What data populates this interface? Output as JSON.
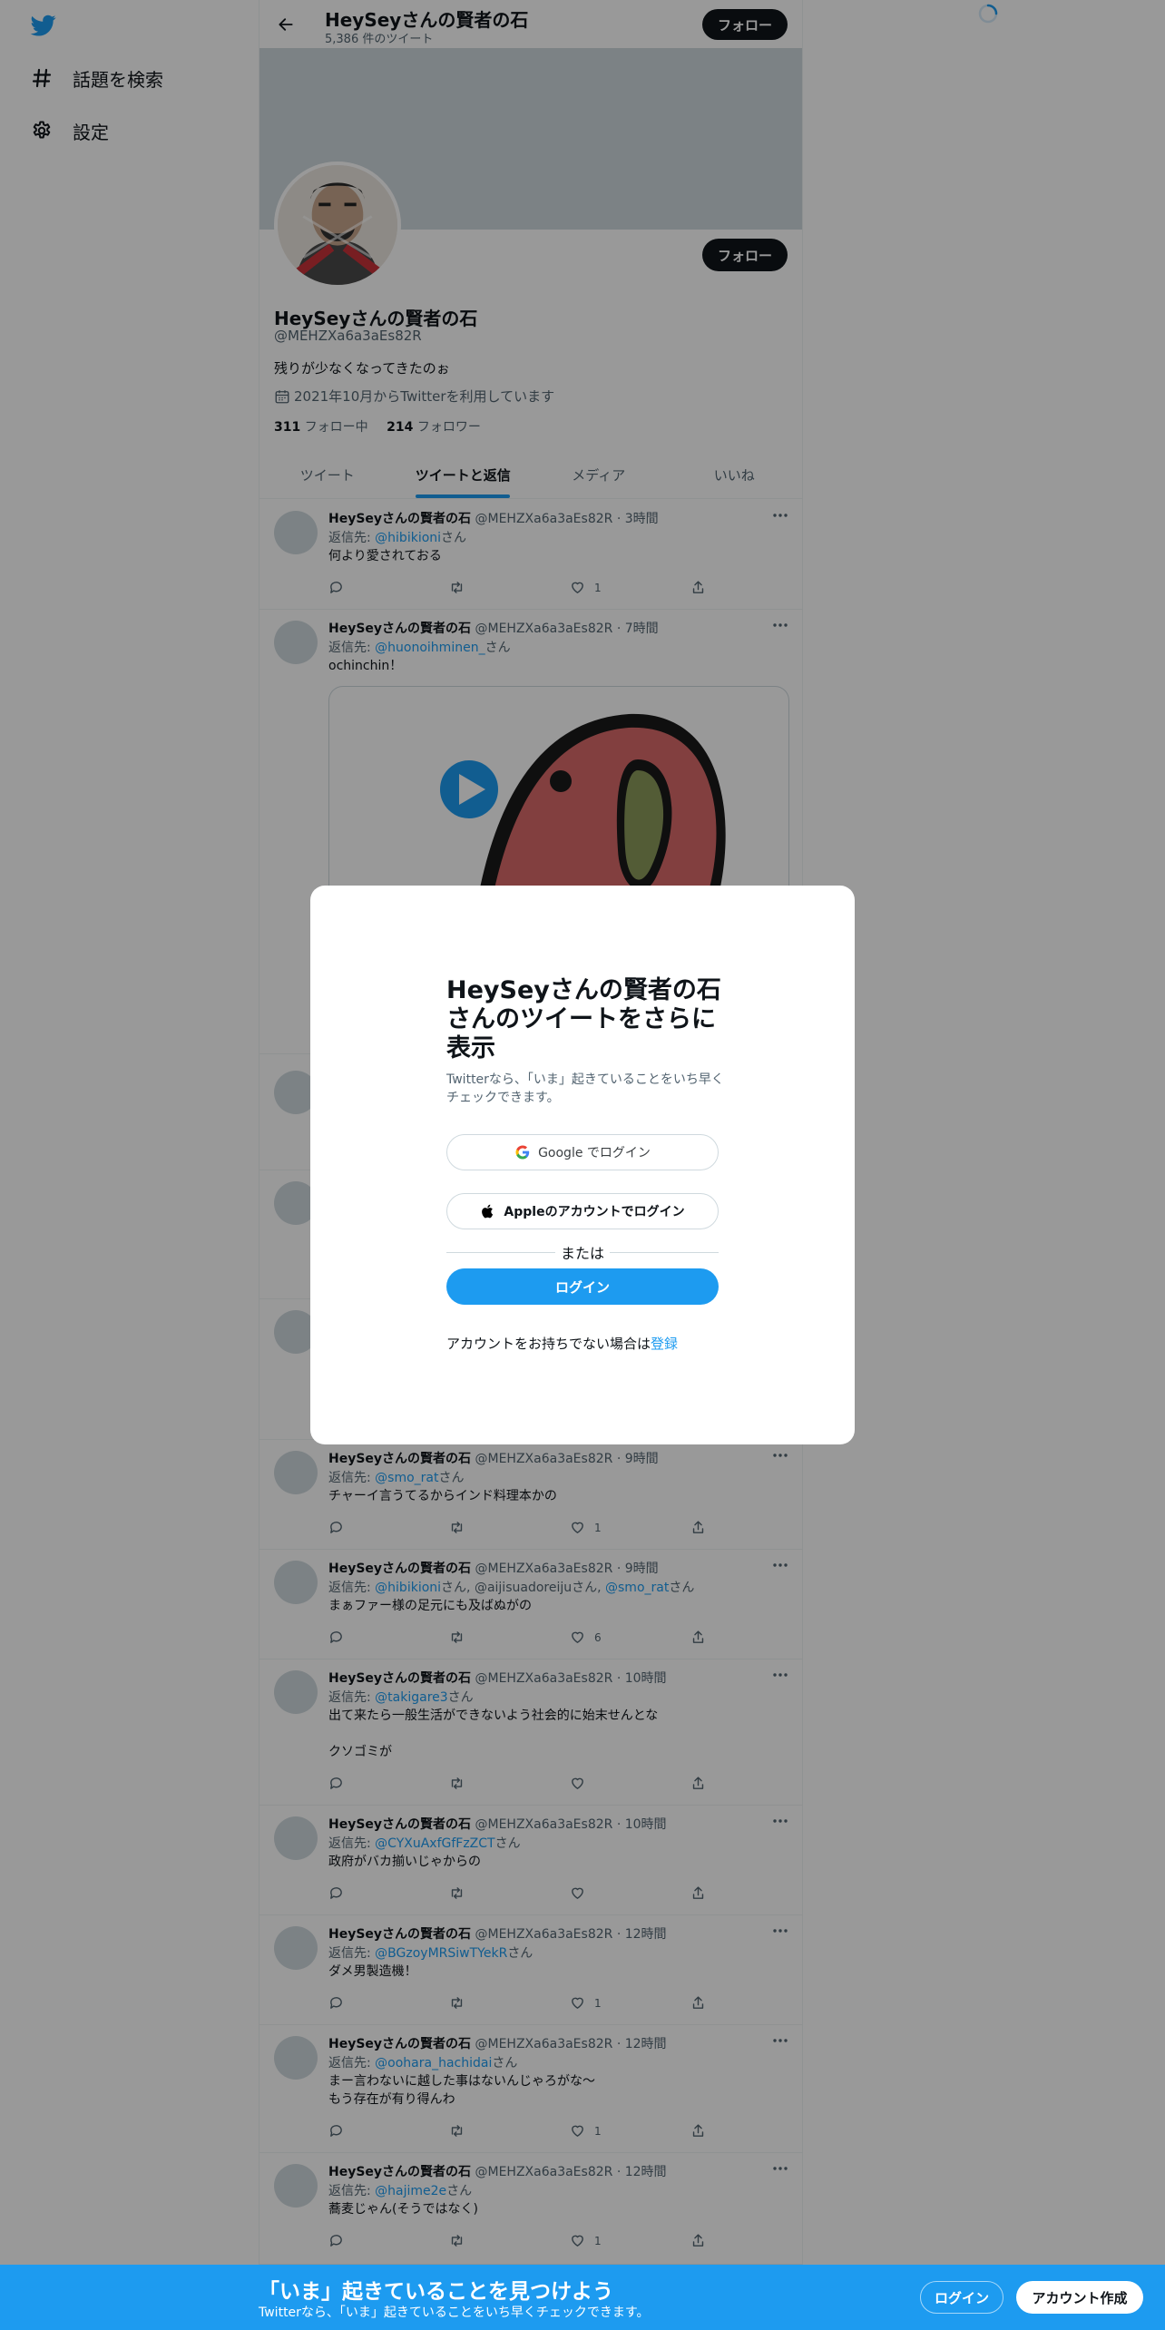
{
  "sidebar": {
    "items": [
      {
        "label": "話題を検索",
        "icon": "hashtag-icon"
      },
      {
        "label": "設定",
        "icon": "gear-icon"
      }
    ]
  },
  "topbar": {
    "title": "HeySeyさんの賢者の石",
    "subtitle": "5,386 件のツイート",
    "follow_label": "フォロー"
  },
  "profile": {
    "follow_label": "フォロー",
    "name": "HeySeyさんの賢者の石",
    "handle": "@MEHZXa6a3aEs82R",
    "bio": "残りが少なくなってきたのぉ",
    "joined": "2021年10月からTwitterを利用しています",
    "following_count": "311",
    "following_label": "フォロー中",
    "followers_count": "214",
    "followers_label": "フォロワー"
  },
  "tabs": [
    {
      "label": "ツイート"
    },
    {
      "label": "ツイートと返信",
      "active": true
    },
    {
      "label": "メディア"
    },
    {
      "label": "いいね"
    }
  ],
  "tweets": [
    {
      "name": "HeySeyさんの賢者の石",
      "meta": "@MEHZXa6a3aEs82R · 3時間",
      "reply_prefix": "返信先: ",
      "reply_to": "@hibikioni",
      "reply_suffix": "さん",
      "text": "何より愛されておる",
      "likes": "1"
    },
    {
      "name": "HeySeyさんの賢者の石",
      "meta": "@MEHZXa6a3aEs82R · 7時間",
      "reply_prefix": "返信先: ",
      "reply_to": "@huonoihminen_",
      "reply_suffix": "さん",
      "text": "ochinchin！"
    },
    {
      "name": "HeySeyさんの賢者の石",
      "meta": "@MEHZXa6a3aEs82R · 9時間",
      "reply_prefix": "返信先: ",
      "reply_to": "@smo_rat",
      "reply_suffix": "さん",
      "text": "チャーイ言うてるからインド料理本かの",
      "likes": "1"
    },
    {
      "name": "HeySeyさんの賢者の石",
      "meta": "@MEHZXa6a3aEs82R · 9時間",
      "reply_prefix": "返信先: ",
      "reply_to": "@hibikioni",
      "reply_mid": "さん, @aijisuadoreijuさん, ",
      "reply_to2": "@smo_rat",
      "reply_suffix": "さん",
      "text": "まぁファー様の足元にも及ばぬがの",
      "likes": "6"
    },
    {
      "name": "HeySeyさんの賢者の石",
      "meta": "@MEHZXa6a3aEs82R · 10時間",
      "reply_prefix": "返信先: ",
      "reply_to": "@takigare3",
      "reply_suffix": "さん",
      "text": "出て来たら一般生活ができないよう社会的に始末せんとな\n\nクソゴミが",
      "likes": ""
    },
    {
      "name": "HeySeyさんの賢者の石",
      "meta": "@MEHZXa6a3aEs82R · 10時間",
      "reply_prefix": "返信先: ",
      "reply_to": "@CYXuAxfGfFzZCT",
      "reply_suffix": "さん",
      "text": "政府がバカ揃いじゃからの",
      "likes": ""
    },
    {
      "name": "HeySeyさんの賢者の石",
      "meta": "@MEHZXa6a3aEs82R · 12時間",
      "reply_prefix": "返信先: ",
      "reply_to": "@BGzoyMRSiwTYekR",
      "reply_suffix": "さん",
      "text": "ダメ男製造機！",
      "likes": "1"
    },
    {
      "name": "HeySeyさんの賢者の石",
      "meta": "@MEHZXa6a3aEs82R · 12時間",
      "reply_prefix": "返信先: ",
      "reply_to": "@oohara_hachidai",
      "reply_suffix": "さん",
      "text": "まー言わないに越した事はないんじゃろがな〜\nもう存在が有り得んわ",
      "likes": "1"
    },
    {
      "name": "HeySeyさんの賢者の石",
      "meta": "@MEHZXa6a3aEs82R · 12時間",
      "reply_prefix": "返信先: ",
      "reply_to": "@hajime2e",
      "reply_suffix": "さん",
      "text": "蕎麦じゃん(そうではなく)",
      "likes": "1"
    }
  ],
  "modal": {
    "title": "HeySeyさんの賢者の石さんのツイートをさらに表示",
    "subtitle": "Twitterなら、「いま」起きていることをいち早くチェックできます。",
    "google_label": "Google でログイン",
    "apple_label": "Appleのアカウントでログイン",
    "or_label": "または",
    "login_label": "ログイン",
    "signup_prompt": "アカウントをお持ちでない場合は",
    "signup_link": "登録"
  },
  "bottom_bar": {
    "title": "「いま」起きていることを見つけよう",
    "subtitle": "Twitterなら、「いま」起きていることをいち早くチェックできます。",
    "login_label": "ログイン",
    "signup_label": "アカウント作成"
  },
  "colors": {
    "accent": "#1d9bf0",
    "text": "#0f1419",
    "muted": "#536471"
  }
}
